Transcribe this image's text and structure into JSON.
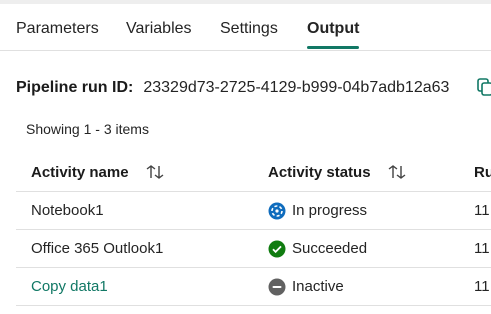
{
  "tabs": [
    {
      "label": "Parameters"
    },
    {
      "label": "Variables"
    },
    {
      "label": "Settings"
    },
    {
      "label": "Output",
      "active": true
    }
  ],
  "pipeline": {
    "run_id_label": "Pipeline run ID:",
    "run_id_value": "23329d73-2725-4129-b999-04b7adb12a63"
  },
  "summary": {
    "showing": "Showing 1 - 3 items"
  },
  "table": {
    "columns": [
      "Activity name",
      "Activity status",
      "Ru"
    ],
    "rows": [
      {
        "name": "Notebook1",
        "status": "In progress",
        "status_icon": "in-progress-icon",
        "run_start": "11,"
      },
      {
        "name": "Office 365 Outlook1",
        "status": "Succeeded",
        "status_icon": "succeeded-check-icon",
        "run_start": "11,"
      },
      {
        "name": "Copy data1",
        "status": "Inactive",
        "status_icon": "inactive-icon",
        "run_start": "11,",
        "link": true
      }
    ]
  },
  "colors": {
    "accent": "#117865",
    "in_progress": "#0f6cbd",
    "succeeded": "#107c10",
    "inactive": "#616161"
  }
}
